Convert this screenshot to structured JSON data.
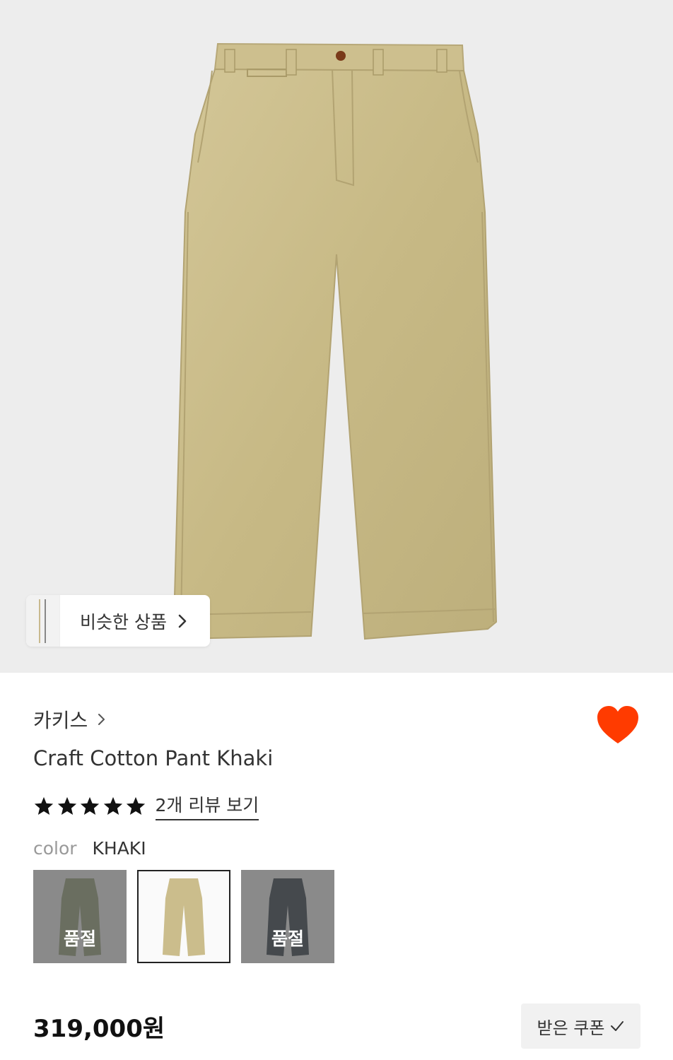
{
  "similar": {
    "label": "비슷한 상품"
  },
  "product": {
    "brand": "카키스",
    "title": "Craft Cotton Pant Khaki",
    "rating_stars": 5,
    "review_link": "2개 리뷰 보기",
    "color_label": "color",
    "color_value": "KHAKI",
    "price": "319,000원"
  },
  "swatches": [
    {
      "color": "olive",
      "soldout_label": "품절"
    },
    {
      "color": "khaki",
      "selected": true
    },
    {
      "color": "charcoal",
      "soldout_label": "품절"
    }
  ],
  "coupon": {
    "label": "받은 쿠폰"
  },
  "colors": {
    "heart": "#ff3b00",
    "khaki": "#c8bb8a",
    "hero_bg": "#ededed"
  }
}
